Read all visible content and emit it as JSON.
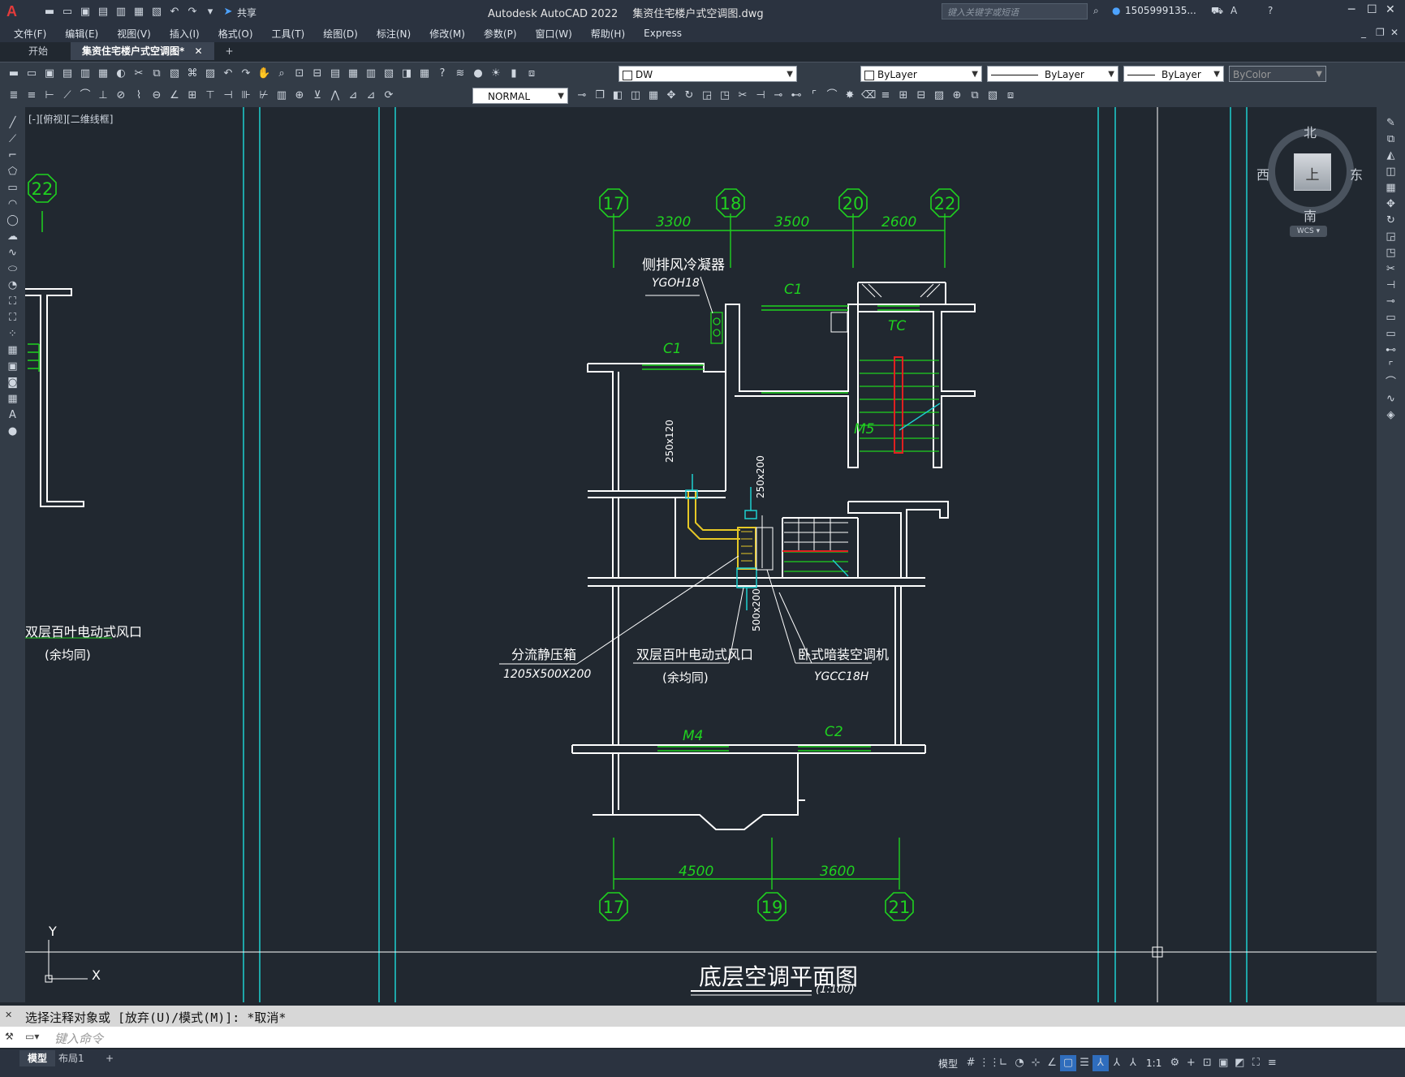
{
  "app": {
    "title": "Autodesk AutoCAD 2022",
    "file": "集资住宅楼户式空调图.dwg",
    "share": "共享",
    "search_placeholder": "键入关键字或短语",
    "user": "1505999135...",
    "window_controls": [
      "minimize-icon",
      "restore-icon",
      "close-icon"
    ]
  },
  "menu": [
    "文件(F)",
    "编辑(E)",
    "视图(V)",
    "插入(I)",
    "格式(O)",
    "工具(T)",
    "绘图(D)",
    "标注(N)",
    "修改(M)",
    "参数(P)",
    "窗口(W)",
    "帮助(H)",
    "Express"
  ],
  "tabs": {
    "start": "开始",
    "active": "集资住宅楼户式空调图*",
    "add": "+"
  },
  "toolbar": {
    "layer": "DW",
    "color": "ByLayer",
    "linetype": "ByLayer",
    "lineweight": "ByLayer",
    "plotstyle": "ByColor",
    "dimstyle": "NORMAL"
  },
  "viewport_label": "[-][俯视][二维线框]",
  "viewcube": {
    "north": "北",
    "south": "南",
    "east": "东",
    "west": "西",
    "face": "上",
    "wcs": "WCS"
  },
  "ucs": {
    "x": "X",
    "y": "Y"
  },
  "drawing": {
    "grid_top": [
      "17",
      "18",
      "20",
      "22"
    ],
    "dims_top": [
      "3300",
      "3500",
      "2600"
    ],
    "grid_bottom": [
      "17",
      "19",
      "21"
    ],
    "dims_bottom": [
      "4500",
      "3600"
    ],
    "left_bubble": "22",
    "labels": {
      "fan_coil": "侧排风冷凝器",
      "fan_coil_model": "YGOH18",
      "c1a": "C1",
      "c1b": "C1",
      "tc": "TC",
      "m5": "M5",
      "m4": "M4",
      "c2": "C2",
      "duct1": "250x120",
      "duct2": "250x200",
      "duct3": "500x200",
      "plenum": "分流静压箱",
      "plenum_size": "1205X500X200",
      "grille": "双层百叶电动式风口",
      "grille_note": "(余均同)",
      "ac_unit": "卧式暗装空调机",
      "ac_model": "YGCC18H",
      "left_grille": "双层百叶电动式风口",
      "left_grille_note": "(余均同)",
      "title": "底层空调平面图",
      "scale": "(1:100)"
    }
  },
  "command": {
    "history": "选择注释对象或 [放弃(U)/模式(M)]: *取消*",
    "placeholder": "键入命令"
  },
  "status": {
    "layout_tabs": [
      "模型",
      "布局1"
    ],
    "model": "模型",
    "scale": "1:1"
  }
}
